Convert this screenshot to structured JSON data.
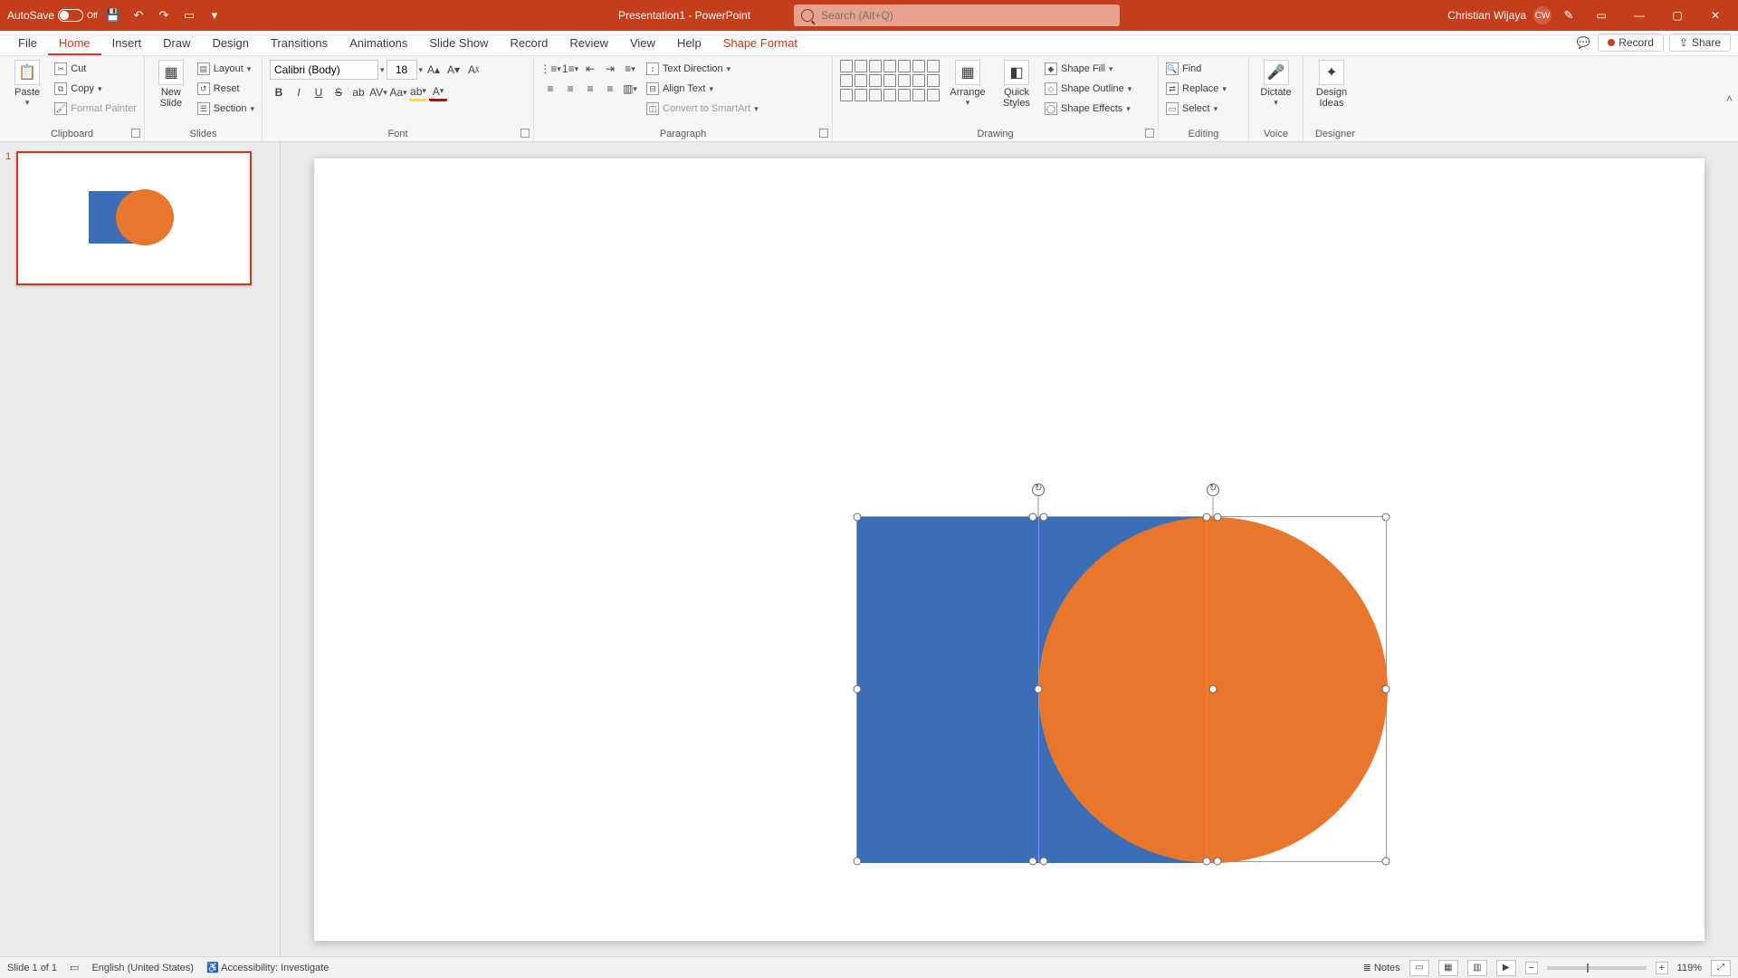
{
  "titlebar": {
    "autosave_label": "AutoSave",
    "autosave_state": "Off",
    "doc_title": "Presentation1 - PowerPoint",
    "search_placeholder": "Search (Alt+Q)",
    "user_name": "Christian Wijaya",
    "user_initials": "CW"
  },
  "menu": {
    "tabs": [
      "File",
      "Home",
      "Insert",
      "Draw",
      "Design",
      "Transitions",
      "Animations",
      "Slide Show",
      "Record",
      "Review",
      "View",
      "Help",
      "Shape Format"
    ],
    "active": "Home",
    "record": "Record",
    "share": "Share"
  },
  "ribbon": {
    "clipboard": {
      "label": "Clipboard",
      "paste": "Paste",
      "cut": "Cut",
      "copy": "Copy",
      "format_painter": "Format Painter"
    },
    "slides": {
      "label": "Slides",
      "new_slide": "New\nSlide",
      "layout": "Layout",
      "reset": "Reset",
      "section": "Section"
    },
    "font": {
      "label": "Font",
      "name": "Calibri (Body)",
      "size": "18"
    },
    "paragraph": {
      "label": "Paragraph",
      "text_direction": "Text Direction",
      "align_text": "Align Text",
      "convert_smartart": "Convert to SmartArt"
    },
    "drawing": {
      "label": "Drawing",
      "arrange": "Arrange",
      "quick_styles": "Quick\nStyles",
      "shape_fill": "Shape Fill",
      "shape_outline": "Shape Outline",
      "shape_effects": "Shape Effects"
    },
    "editing": {
      "label": "Editing",
      "find": "Find",
      "replace": "Replace",
      "select": "Select"
    },
    "voice": {
      "label": "Voice",
      "dictate": "Dictate"
    },
    "designer": {
      "label": "Designer",
      "design_ideas": "Design\nIdeas"
    }
  },
  "status": {
    "slide_index": "Slide 1 of 1",
    "language": "English (United States)",
    "accessibility": "Accessibility: Investigate",
    "notes": "Notes",
    "zoom": "119%"
  },
  "thumbnail": {
    "number": "1"
  },
  "colors": {
    "accent": "#c43e1c",
    "rect": "#3a6fb7",
    "circle": "#e8762d"
  }
}
